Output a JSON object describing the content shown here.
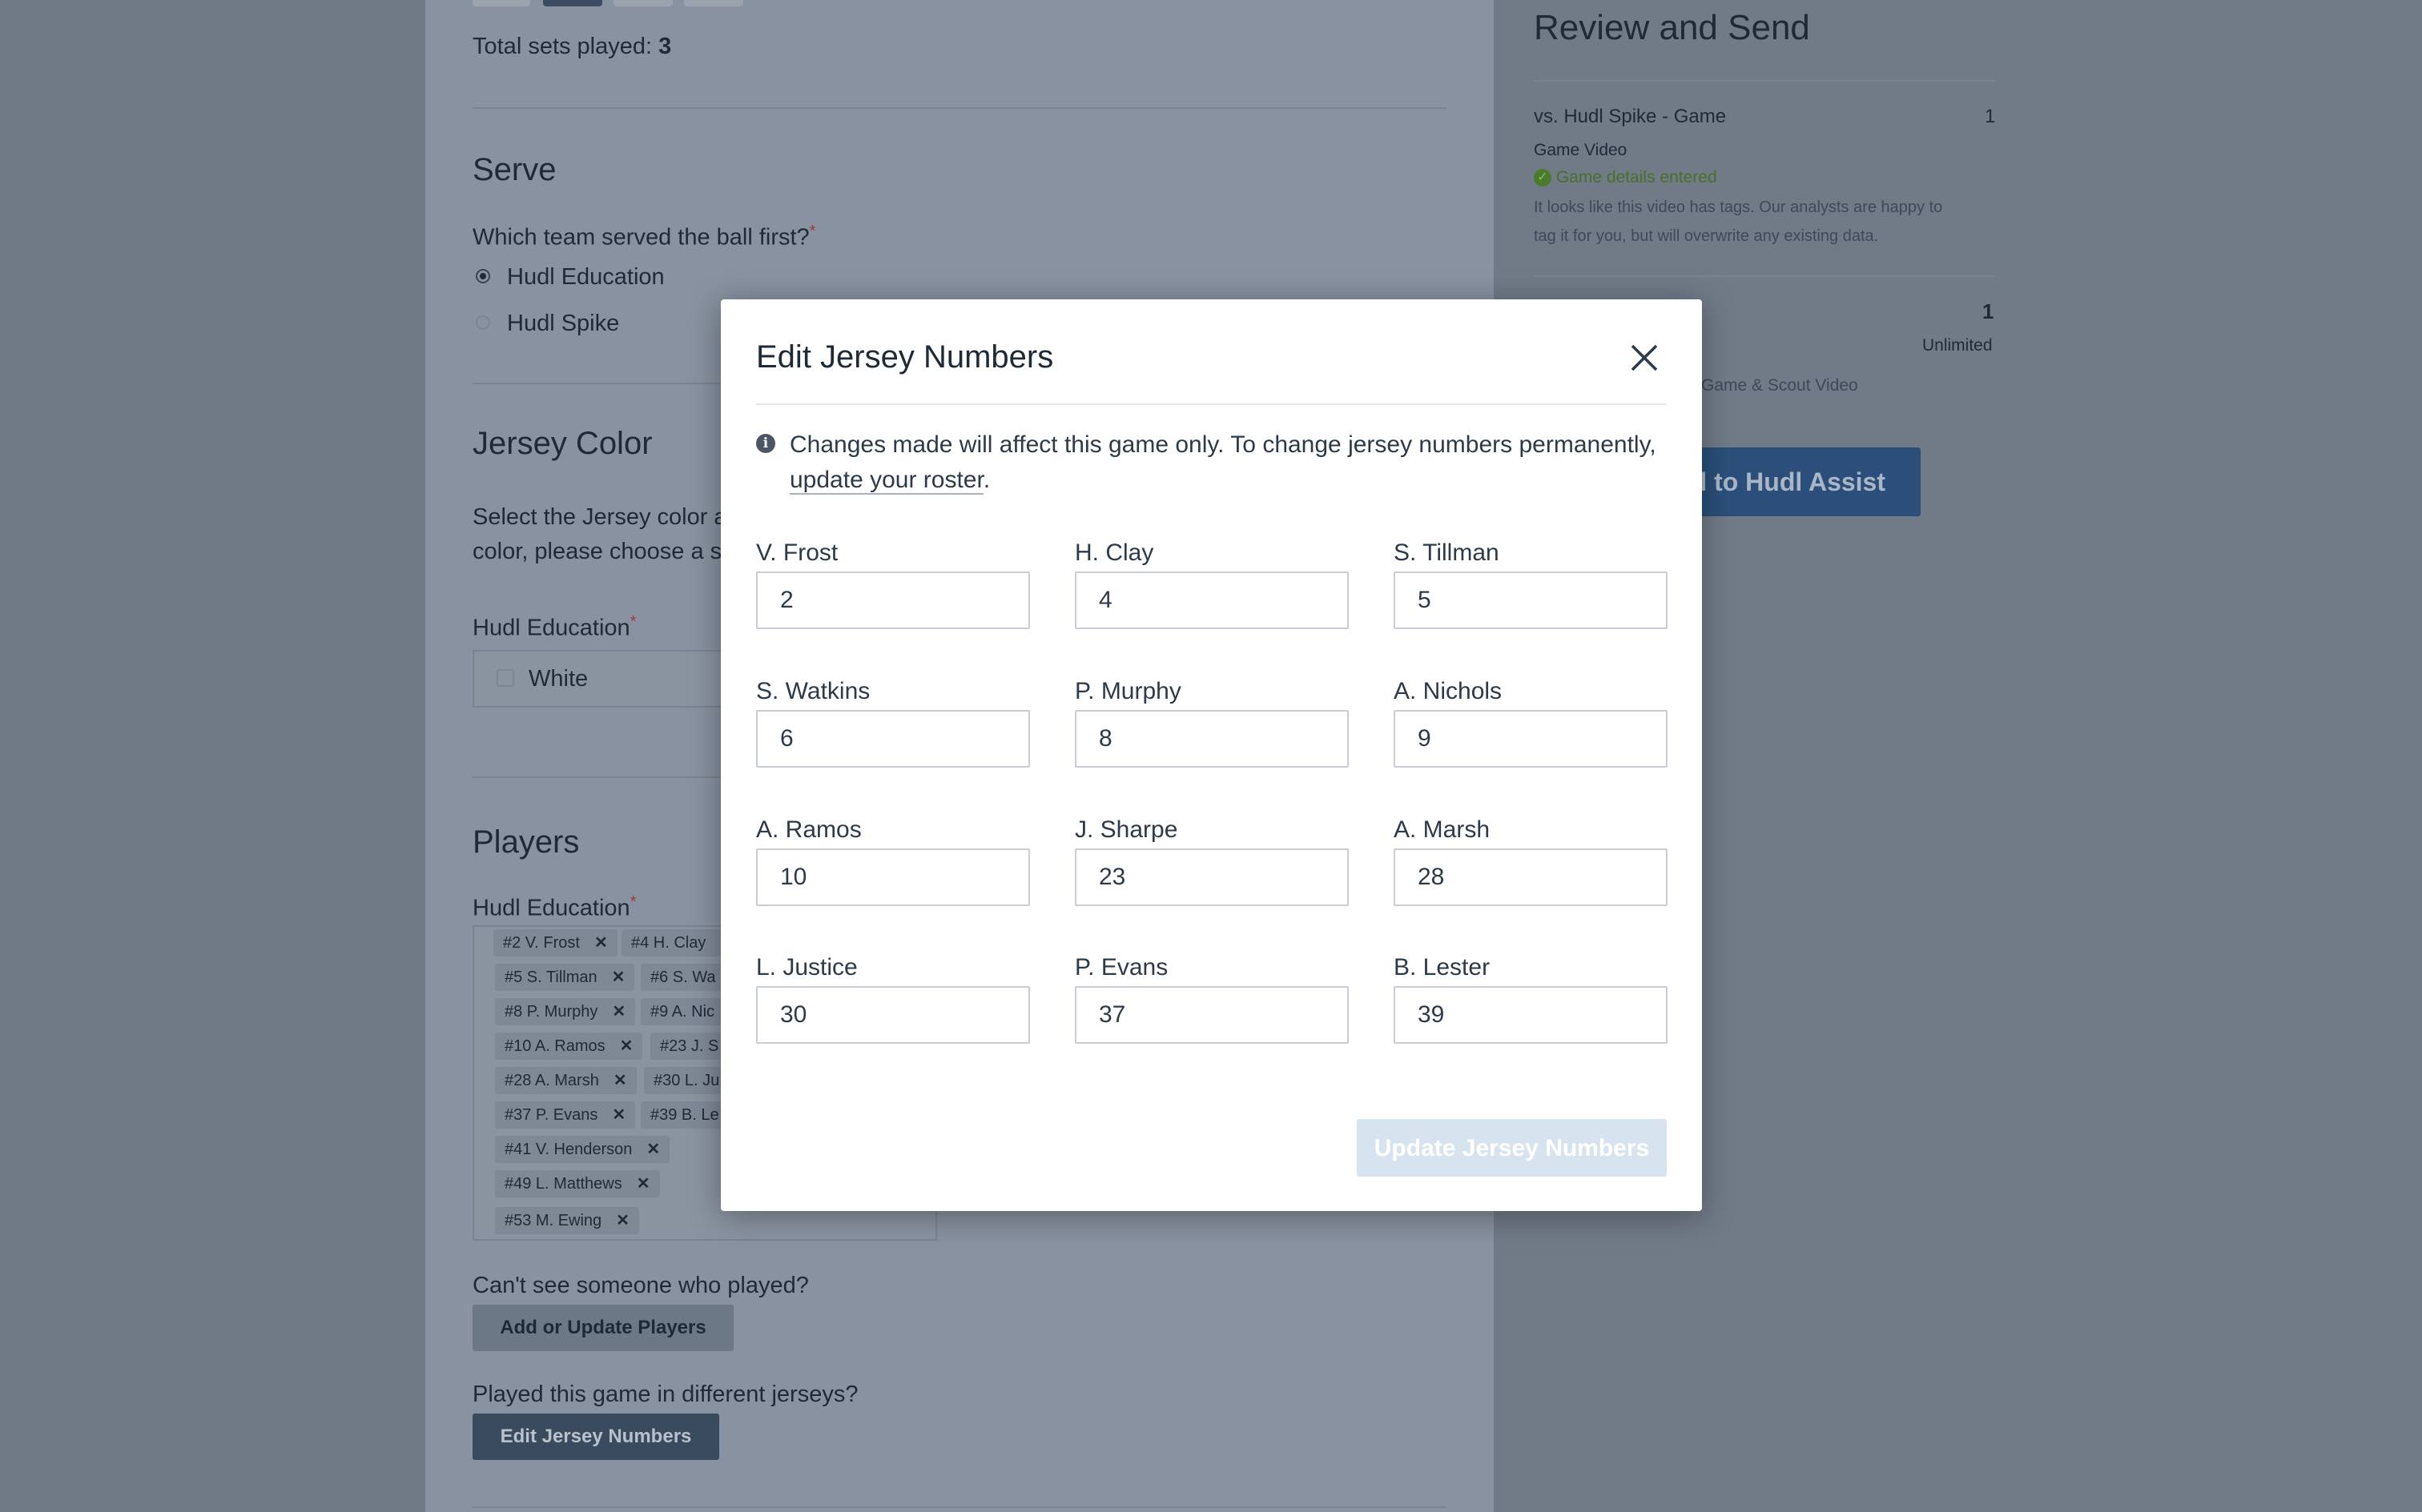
{
  "main": {
    "total_sets_label": "Total sets played:",
    "total_sets_value": "3",
    "serve": {
      "heading": "Serve",
      "question": "Which team served the ball first?",
      "required_mark": "*",
      "options": [
        "Hudl Education",
        "Hudl Spike"
      ],
      "selected": "Hudl Education"
    },
    "jersey_color": {
      "heading": "Jersey Color",
      "desc_line1": "Select the Jersey color a",
      "desc_line2": "color, please choose a s",
      "team_label": "Hudl Education",
      "required_mark": "*",
      "selected_color": "White"
    },
    "players": {
      "heading": "Players",
      "team_label": "Hudl Education",
      "required_mark": "*",
      "chips": [
        "#2 V. Frost",
        "#4 H. Clay",
        "#5 S. Tillman",
        "#6 S. Wa",
        "#8 P. Murphy",
        "#9 A. Nic",
        "#10 A. Ramos",
        "#23 J. S",
        "#28 A. Marsh",
        "#30 L. Ju",
        "#37 P. Evans",
        "#39 B. Le",
        "#41 V. Henderson",
        "#49 L. Matthews",
        "#53 M. Ewing"
      ],
      "remove_glyph": "✕",
      "cant_see_text": "Can't see someone who played?",
      "add_update_button": "Add or Update Players",
      "different_jerseys_text": "Played this game in different jerseys?",
      "edit_jersey_button": "Edit Jersey Numbers"
    }
  },
  "review": {
    "title": "Review and Send",
    "item1_title": "vs. Hudl Spike - Game",
    "item1_count": "1",
    "item1_type": "Game Video",
    "item1_status": "Game details entered",
    "item1_note_line1": "It looks like this video has tags. Our analysts are happy to",
    "item1_note_line2": "tag it for you, but will overwrite any existing data.",
    "item2_count": "1",
    "item2_limit": "Unlimited",
    "item2_note": "Game & Scout Video",
    "send_button": "d to Hudl Assist"
  },
  "modal": {
    "title": "Edit Jersey Numbers",
    "info_text": "Changes made will affect this game only. To change jersey numbers permanently,",
    "info_link": "update your roster",
    "info_end": ".",
    "players": [
      {
        "name": "V. Frost",
        "number": "2"
      },
      {
        "name": "H. Clay",
        "number": "4"
      },
      {
        "name": "S. Tillman",
        "number": "5"
      },
      {
        "name": "S. Watkins",
        "number": "6"
      },
      {
        "name": "P. Murphy",
        "number": "8"
      },
      {
        "name": "A. Nichols",
        "number": "9"
      },
      {
        "name": "A. Ramos",
        "number": "10"
      },
      {
        "name": "J. Sharpe",
        "number": "23"
      },
      {
        "name": "A. Marsh",
        "number": "28"
      },
      {
        "name": "L. Justice",
        "number": "30"
      },
      {
        "name": "P. Evans",
        "number": "37"
      },
      {
        "name": "B. Lester",
        "number": "39"
      }
    ],
    "submit_button": "Update Jersey Numbers",
    "close_icon": "close-icon"
  },
  "colors": {
    "overlay": "#707a86",
    "primary_dark": "#3a4a5f",
    "assist_blue": "#2b4f7a",
    "disabled_button": "#d7e4f0",
    "required_red": "#a33a3a",
    "success_green": "#4b7a2a"
  }
}
